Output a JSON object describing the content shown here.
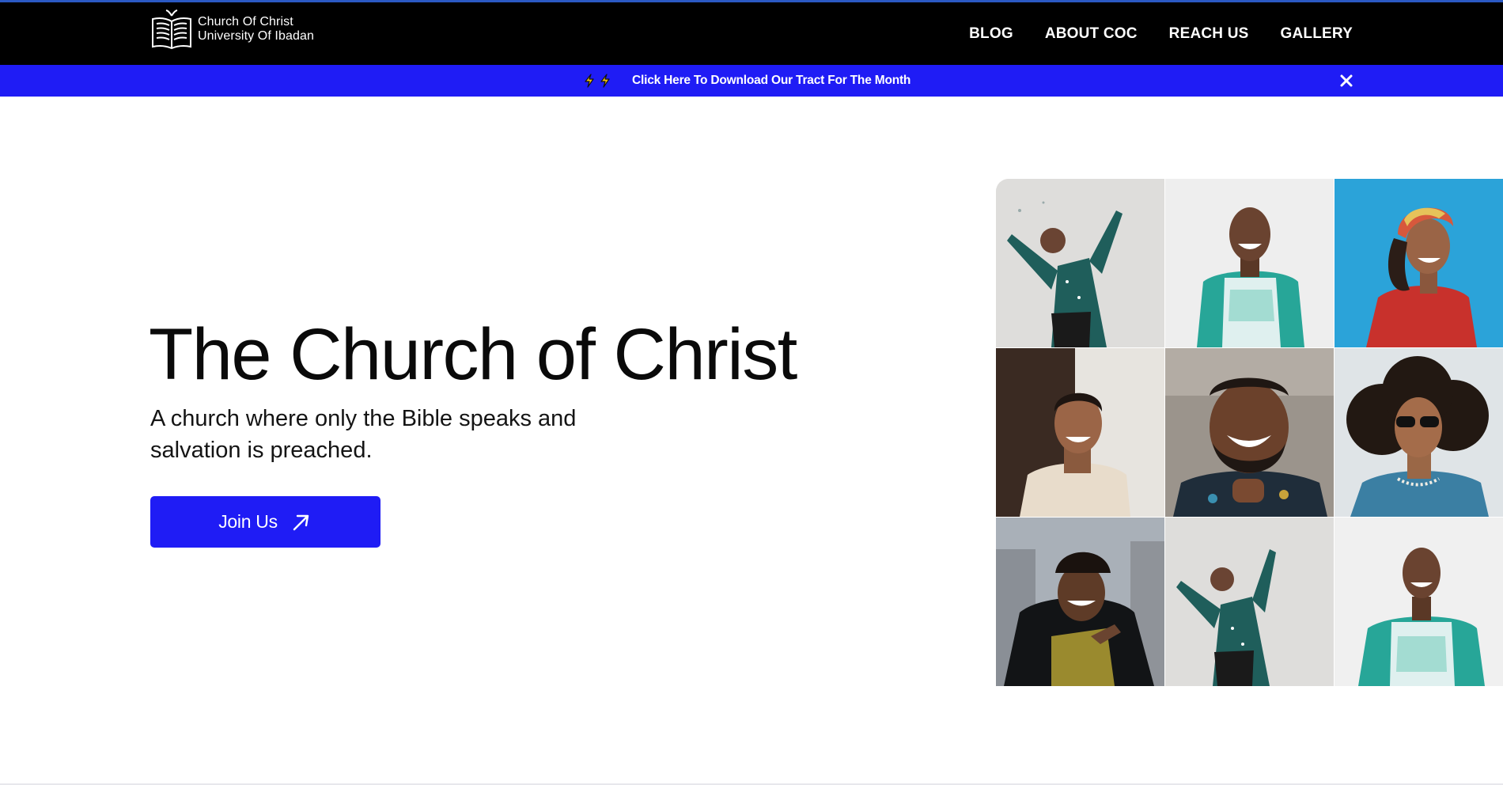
{
  "brand": {
    "line1": "Church Of Christ",
    "line2": "University Of Ibadan",
    "logo_icon": "open-book-icon"
  },
  "nav": {
    "items": [
      {
        "label": "BLOG"
      },
      {
        "label": "ABOUT COC"
      },
      {
        "label": "REACH US"
      },
      {
        "label": "GALLERY"
      }
    ]
  },
  "banner": {
    "icons": [
      "lightning-icon",
      "lightning-icon"
    ],
    "text": "Click Here To Download Our Tract For The Month",
    "close_icon": "close-icon",
    "background": "#1f1cf5"
  },
  "hero": {
    "title": "The Church of Christ",
    "subtitle": "A church where only the Bible speaks and salvation is preached.",
    "cta_label": "Join Us",
    "cta_icon": "arrow-up-right-icon"
  },
  "gallery": {
    "photos": [
      "person-celebrating-photo",
      "smiling-man-jersey-photo",
      "woman-headwrap-photo",
      "smiling-young-man-photo",
      "laughing-bearded-man-photo",
      "man-sunglasses-photo",
      "laughing-woman-braids-photo",
      "person-celebrating-photo",
      "smiling-man-jersey-photo"
    ]
  },
  "colors": {
    "accent": "#1f1cf5",
    "navbar": "#000000",
    "text": "#0a0a0a"
  }
}
